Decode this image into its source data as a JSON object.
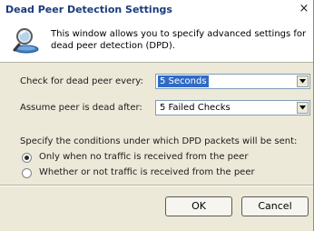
{
  "window": {
    "title": "Dead Peer Detection Settings",
    "close_glyph": "×"
  },
  "header": {
    "description": "This window allows you to specify advanced settings for dead peer detection (DPD).",
    "icon": "dpd-search-icon"
  },
  "check_interval": {
    "label": "Check for dead peer every:",
    "value": "5 Seconds"
  },
  "failure_threshold": {
    "label": "Assume peer is dead after:",
    "value": "5 Failed Checks"
  },
  "conditions": {
    "prompt": "Specify the conditions under which DPD packets will be sent:",
    "options": [
      {
        "label": "Only when no traffic is received from the peer",
        "selected": true
      },
      {
        "label": "Whether or not traffic is received from the peer",
        "selected": false
      }
    ]
  },
  "buttons": {
    "ok": "OK",
    "cancel": "Cancel"
  },
  "colors": {
    "title_text": "#1a3c7c",
    "selection_highlight": "#316ac5",
    "dialog_background": "#ece9d8"
  }
}
